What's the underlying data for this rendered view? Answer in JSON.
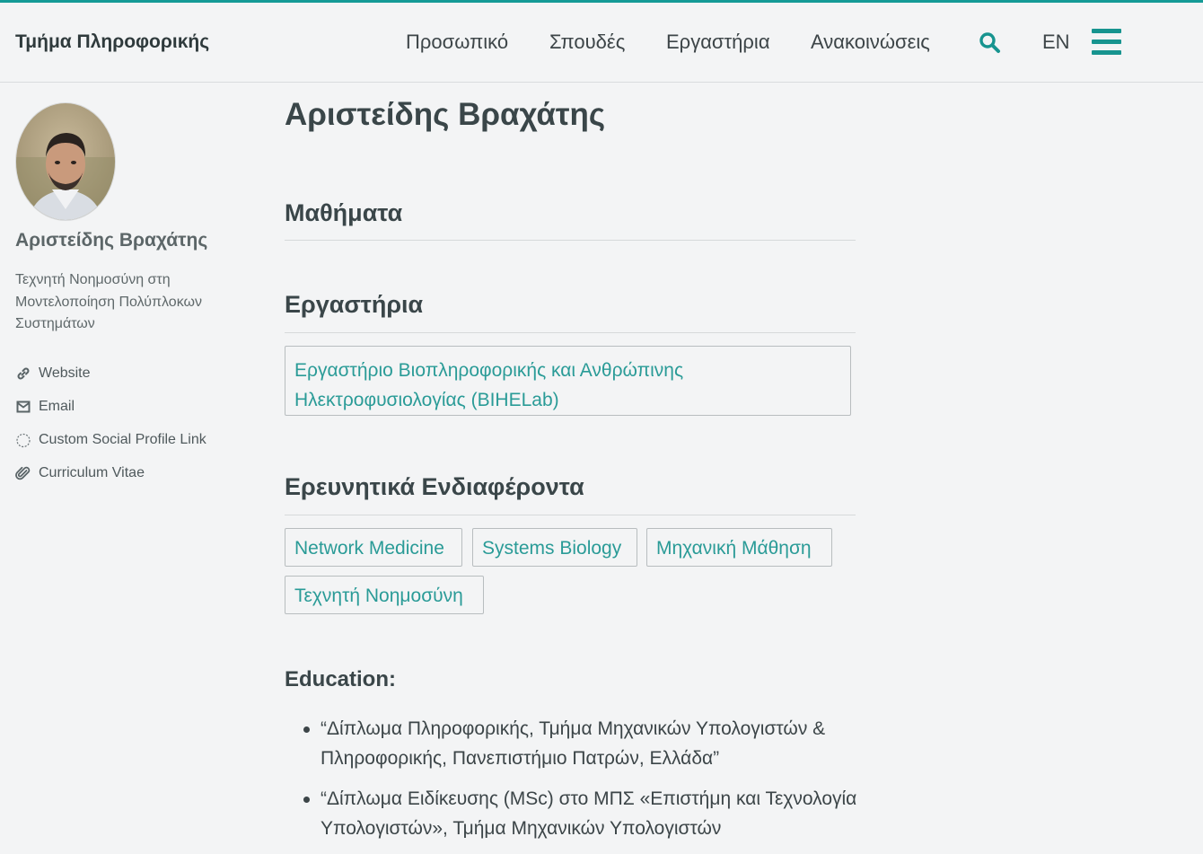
{
  "header": {
    "brand": "Τμήμα Πληροφορικής",
    "nav": [
      "Προσωπικό",
      "Σπουδές",
      "Εργαστήρια",
      "Ανακοινώσεις"
    ],
    "search_icon": "search-icon",
    "lang": "EN",
    "menu_icon": "hamburger-menu-icon"
  },
  "sidebar": {
    "name": "Αριστείδης Βραχάτης",
    "role": "Τεχνητή Νοημοσύνη στη Μοντελοποίηση Πολύπλοκων Συστημάτων",
    "links": [
      {
        "label": "Website",
        "icon": "link-icon"
      },
      {
        "label": "Email",
        "icon": "email-icon"
      },
      {
        "label": "Custom Social Profile Link",
        "icon": "circle-icon"
      },
      {
        "label": "Curriculum Vitae",
        "icon": "paperclip-icon"
      }
    ]
  },
  "main": {
    "title": "Αριστείδης Βραχάτης",
    "courses_heading": "Μαθήματα",
    "labs_heading": "Εργαστήρια",
    "lab": "Εργαστήριο Βιοπληροφορικής και Ανθρώπινης Ηλεκτροφυσιολογίας (BIHELab)",
    "interests_heading": "Ερευνητικά Ενδιαφέροντα",
    "interests": [
      "Network Medicine",
      "Systems Biology",
      "Μηχανική Μάθηση",
      "Τεχνητή Νοημοσύνη"
    ],
    "education_heading": "Education:",
    "education": [
      "“Δίπλωμα Πληροφορικής, Τμήμα Μηχανικών Υπολογιστών & Πληροφορικής, Πανεπιστήμιο Πατρών, Ελλάδα”",
      "“Δίπλωμα Ειδίκευσης (MSc) στο ΜΠΣ «Επιστήμη και Τεχνολογία Υπολογιστών», Τμήμα Μηχανικών Υπολογιστών"
    ]
  },
  "colors": {
    "accent": "#159a96",
    "link": "#2a9b97",
    "text": "#3c4548"
  }
}
